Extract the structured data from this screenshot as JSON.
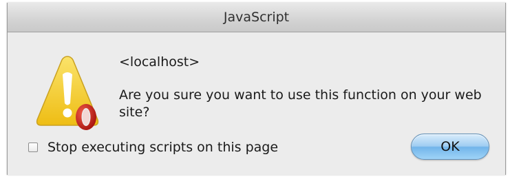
{
  "window": {
    "title": "JavaScript"
  },
  "dialog": {
    "origin": "<localhost>",
    "message": "Are you sure you want to use this function on your web site?",
    "icon": "warning-triangle-with-opera-badge-icon"
  },
  "options": {
    "stop_scripts_label": "Stop executing scripts on this page",
    "stop_scripts_checked": false
  },
  "buttons": {
    "ok_label": "OK"
  },
  "colors": {
    "warning_yellow": "#f5cc2a",
    "opera_red": "#c3261c",
    "button_blue": "#8cc6f1"
  }
}
